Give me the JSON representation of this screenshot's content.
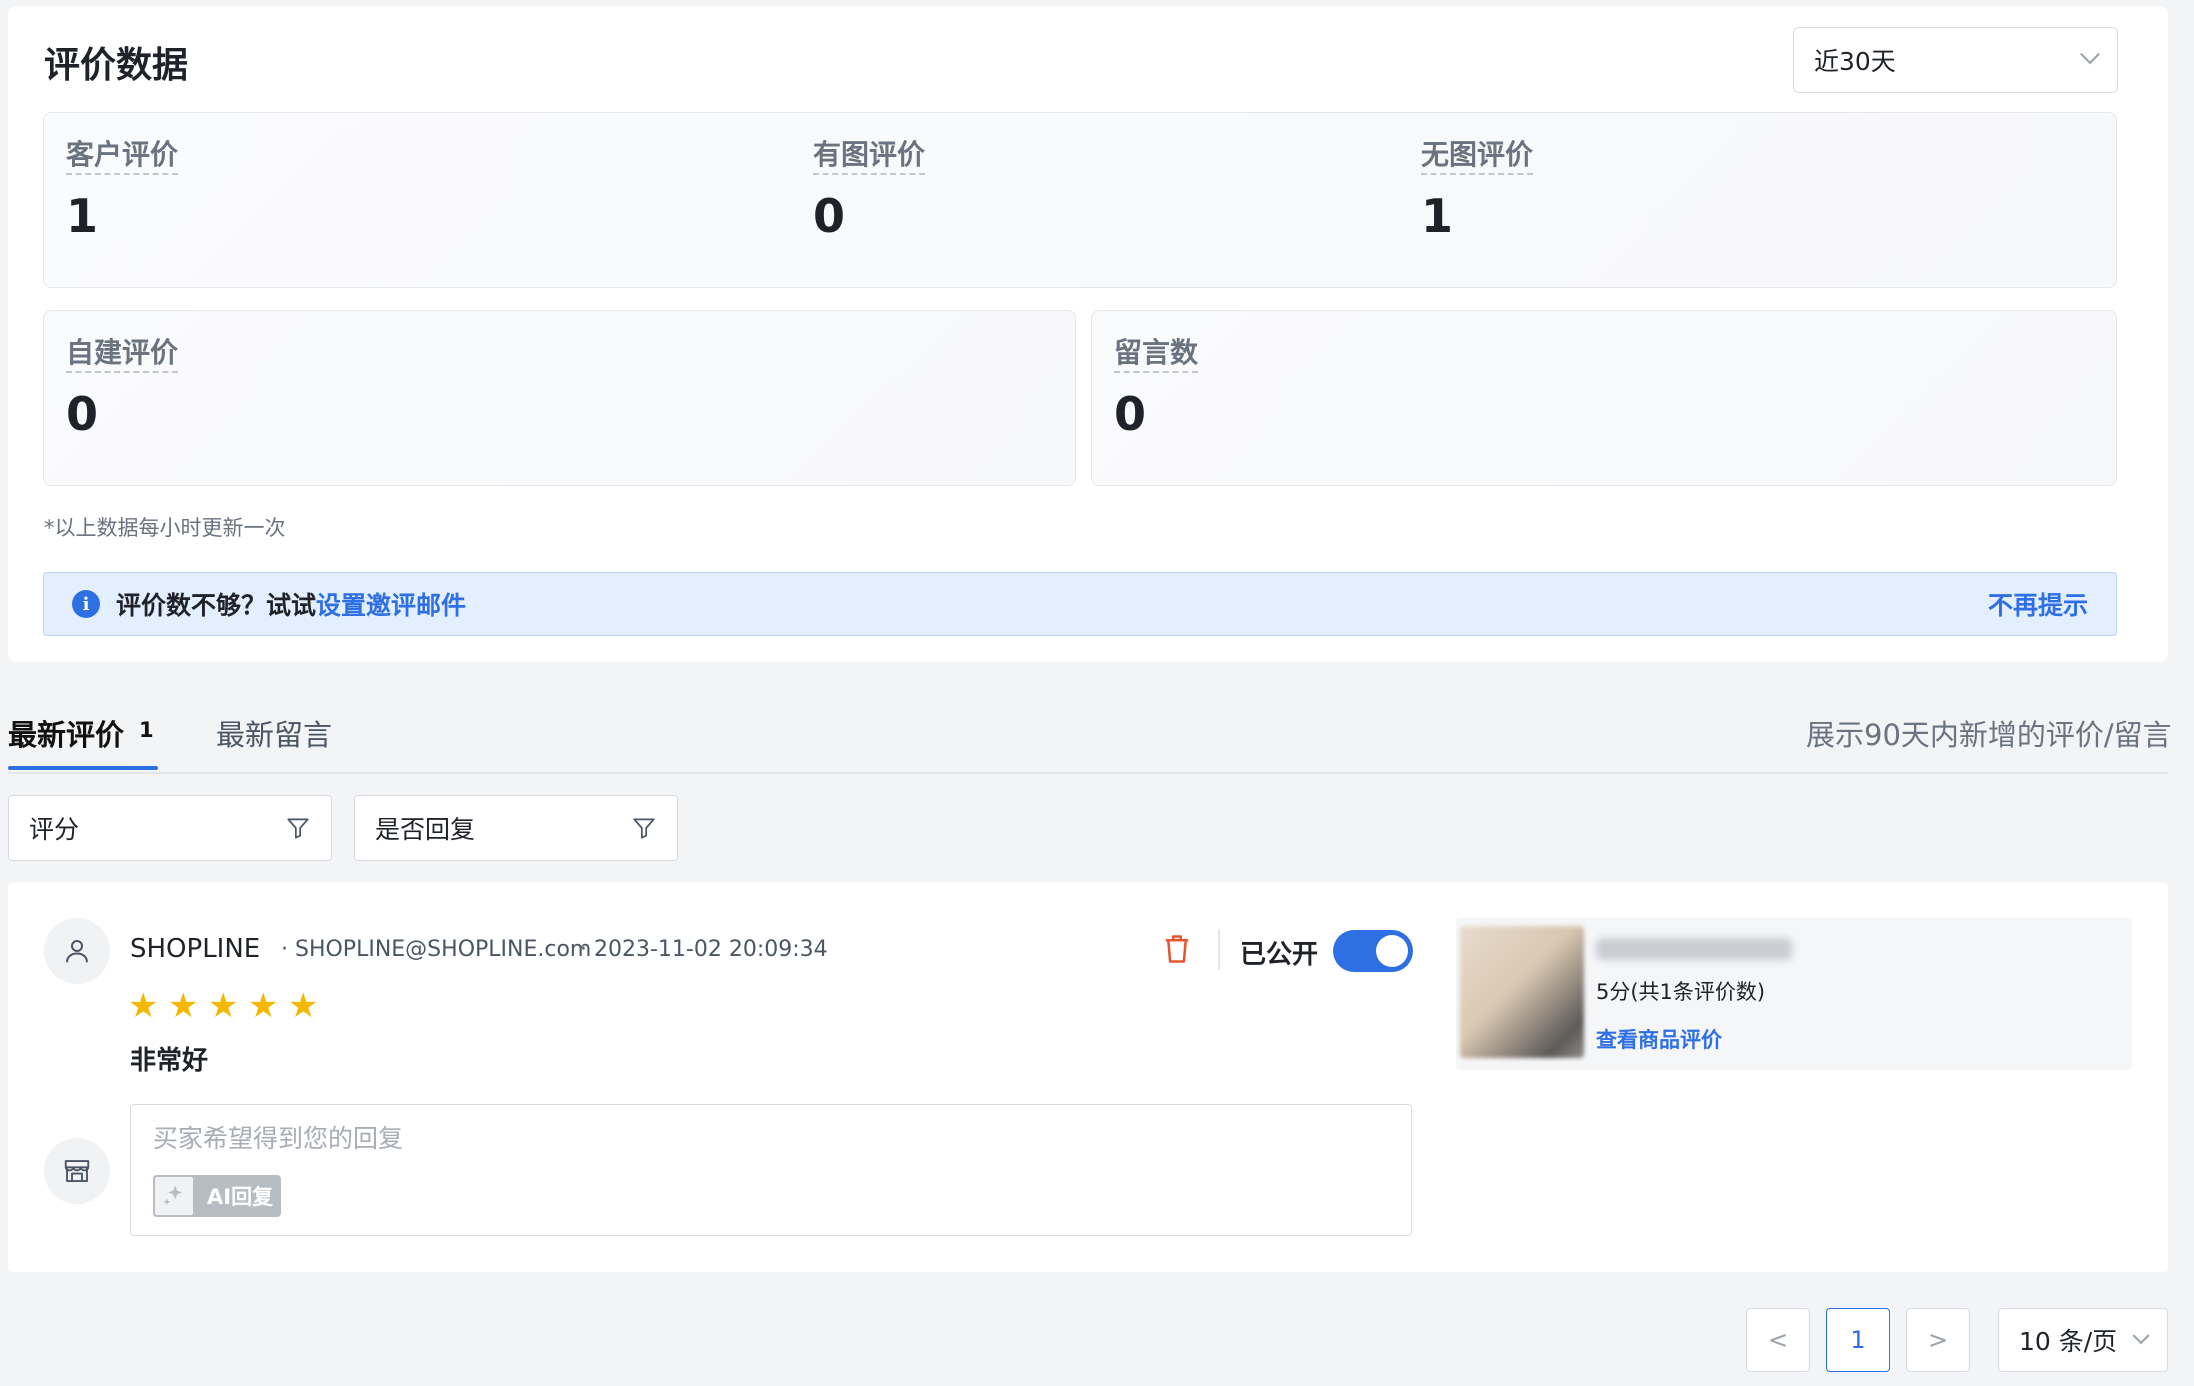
{
  "header": {
    "title": "评价数据",
    "range": "近30天"
  },
  "stats": {
    "customer_reviews": {
      "label": "客户评价",
      "value": "1"
    },
    "with_images": {
      "label": "有图评价",
      "value": "0"
    },
    "without_images": {
      "label": "无图评价",
      "value": "1"
    },
    "self_built": {
      "label": "自建评价",
      "value": "0"
    },
    "comments": {
      "label": "留言数",
      "value": "0"
    }
  },
  "footnote": "*以上数据每小时更新一次",
  "banner": {
    "text": "评价数不够？试试",
    "link": "设置邀评邮件",
    "dismiss": "不再提示"
  },
  "tabs": {
    "active_label": "最新评价",
    "active_count": "1",
    "inactive_label": "最新留言",
    "note": "展示90天内新增的评价/留言"
  },
  "filters": {
    "rating": "评分",
    "replied": "是否回复"
  },
  "review": {
    "reviewer": "SHOPLINE",
    "email": "· SHOPLINE@SHOPLINE.com",
    "date": "· 2023-11-02 20:09:34",
    "stars": 5,
    "text": "非常好",
    "public_label": "已公开",
    "public_on": true,
    "reply_placeholder": "买家希望得到您的回复",
    "ai_reply": "AI回复"
  },
  "product": {
    "rating_text": "5分(共1条评价数)",
    "link": "查看商品评价"
  },
  "pagination": {
    "prev": "<",
    "current": "1",
    "next": ">",
    "per_page": "10 条/页"
  },
  "colors": {
    "accent": "#2f6fe4",
    "star": "#f5b800",
    "delete": "#e8552d"
  }
}
